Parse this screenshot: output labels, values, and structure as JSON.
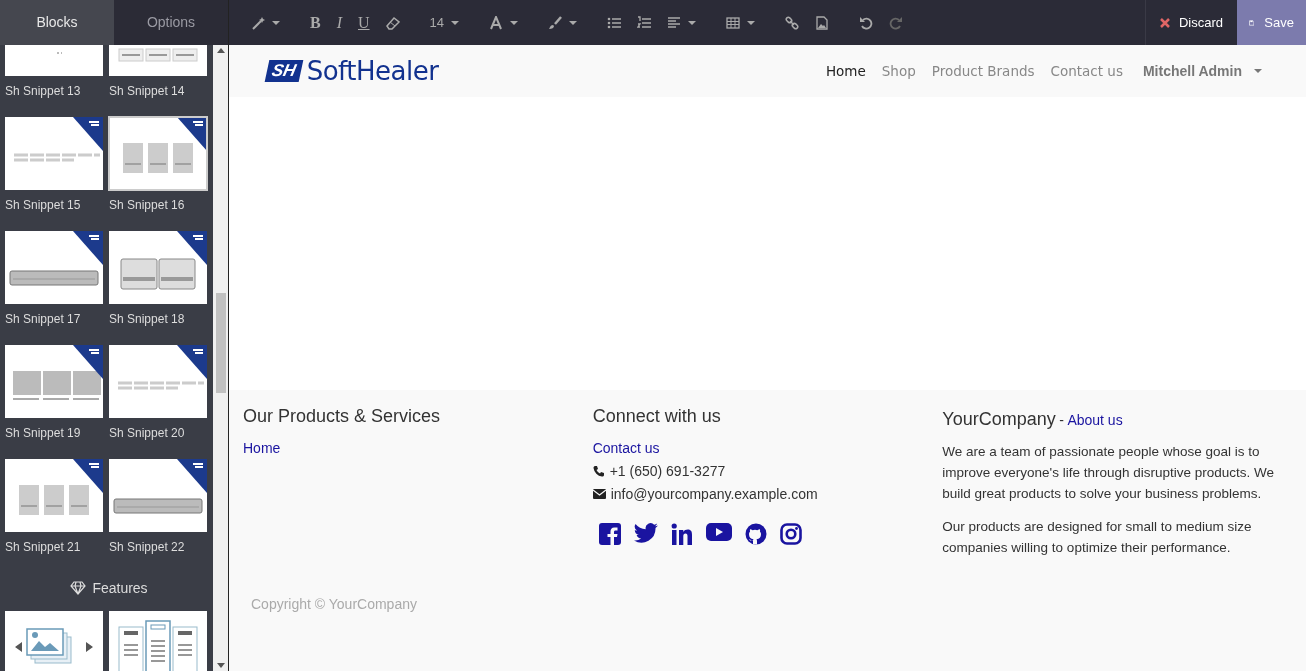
{
  "sidebar": {
    "tabs": [
      {
        "label": "Blocks",
        "selected": true
      },
      {
        "label": "Options",
        "selected": false
      }
    ],
    "snippets": [
      {
        "label": "Sh Snippet 13",
        "hovered": false
      },
      {
        "label": "Sh Snippet 14",
        "hovered": false
      },
      {
        "label": "Sh Snippet 15",
        "hovered": false
      },
      {
        "label": "Sh Snippet 16",
        "hovered": true
      },
      {
        "label": "Sh Snippet 17",
        "hovered": false
      },
      {
        "label": "Sh Snippet 18",
        "hovered": false
      },
      {
        "label": "Sh Snippet 19",
        "hovered": false
      },
      {
        "label": "Sh Snippet 20",
        "hovered": false
      },
      {
        "label": "Sh Snippet 21",
        "hovered": false
      },
      {
        "label": "Sh Snippet 22",
        "hovered": false
      }
    ],
    "section_title": "Features"
  },
  "toolbar": {
    "bold": "B",
    "italic": "I",
    "underline": "U",
    "font_size": "14",
    "discard": "Discard",
    "save": "Save"
  },
  "site": {
    "logo_mark": "SH",
    "logo_name": "SoftHealer",
    "menu": [
      {
        "label": "Home",
        "selected": true
      },
      {
        "label": "Shop",
        "selected": false
      },
      {
        "label": "Product Brands",
        "selected": false
      },
      {
        "label": "Contact us",
        "selected": false
      }
    ],
    "user": "Mitchell Admin"
  },
  "footer": {
    "col1": {
      "title": "Our Products & Services",
      "links": [
        "Home"
      ]
    },
    "col2": {
      "title": "Connect with us",
      "link": "Contact us",
      "phone": "+1 (650) 691-3277",
      "email": "info@yourcompany.example.com"
    },
    "col3": {
      "title": "YourCompany",
      "link": "About us",
      "separator": "-",
      "paragraphs": [
        "We are a team of passionate people whose goal is to improve everyone's life through disruptive products. We build great products to solve your business problems.",
        "Our products are designed for small to medium size companies willing to optimize their performance."
      ]
    },
    "copyright": "Copyright © YourCompany"
  }
}
